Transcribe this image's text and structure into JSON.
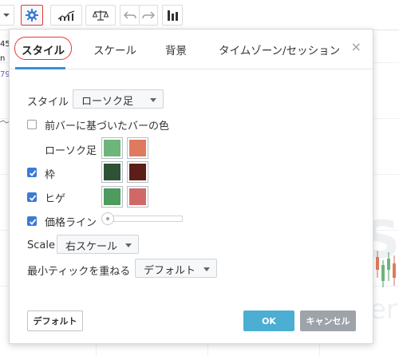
{
  "toolbar": {
    "buttons": [
      {
        "name": "dropdown-arrow-button",
        "icon": "caret-down-icon"
      },
      {
        "name": "settings-button",
        "icon": "gear-icon"
      },
      {
        "name": "indicators-button",
        "icon": "indicators-icon"
      },
      {
        "name": "compare-button",
        "icon": "scales-icon"
      },
      {
        "name": "undo-button",
        "icon": "undo-arrow-icon"
      },
      {
        "name": "redo-button",
        "icon": "redo-arrow-icon"
      },
      {
        "name": "chart-type-button",
        "icon": "bar-chart-icon"
      }
    ],
    "active_color": "#e53935"
  },
  "chart_background": {
    "axis_numbers": [
      "45",
      "n",
      "79"
    ],
    "watermark_large": "S",
    "watermark_small": "er"
  },
  "dialog": {
    "tabs": [
      {
        "label": "スタイル",
        "active": true
      },
      {
        "label": "スケール",
        "active": false
      },
      {
        "label": "背景",
        "active": false
      },
      {
        "label": "タイムゾーン/セッション",
        "active": false
      }
    ],
    "close_label": "×",
    "style_label": "スタイル",
    "style_value": "ローソク足",
    "prev_bar_color": {
      "label": "前バーに基づいたバーの色",
      "checked": false
    },
    "candles": {
      "label": "ローソク足",
      "up_color": "#6db57b",
      "down_color": "#e07a5f"
    },
    "border": {
      "label": "枠",
      "checked": true,
      "up_color": "#2f5235",
      "down_color": "#5c1e16"
    },
    "wick": {
      "label": "ヒゲ",
      "checked": true,
      "up_color": "#4f9a5d",
      "down_color": "#d06868"
    },
    "price_line": {
      "label": "価格ライン",
      "checked": true,
      "slider_value": 0
    },
    "scale": {
      "label": "Scale",
      "value": "右スケール"
    },
    "min_tick": {
      "label": "最小ティックを重ねる",
      "value": "デフォルト"
    },
    "buttons": {
      "default": "デフォルト",
      "ok": "OK",
      "cancel": "キャンセル"
    },
    "accent_color": "#3a8fd6",
    "ok_color": "#4caed3",
    "cancel_color": "#9ea3aa"
  }
}
